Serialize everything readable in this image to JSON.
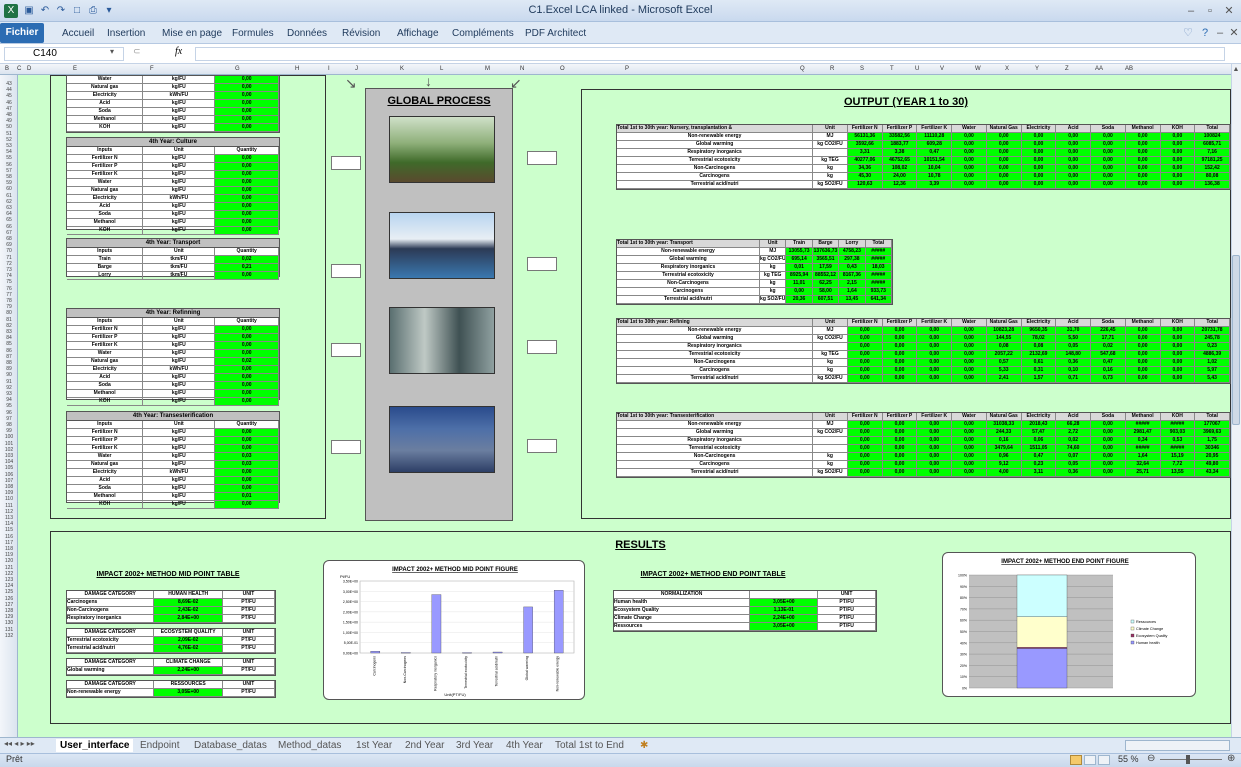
{
  "window": {
    "title": "C1.Excel LCA linked - Microsoft Excel"
  },
  "ribbon": {
    "file_tab": "Fichier",
    "tabs": [
      "Accueil",
      "Insertion",
      "Mise en page",
      "Formules",
      "Données",
      "Révision",
      "Affichage",
      "Compléments",
      "PDF Architect"
    ]
  },
  "formula": {
    "name_box": "C140",
    "fx": "fx",
    "value": ""
  },
  "columns": [
    "B",
    "C",
    "D",
    "E",
    "F",
    "G",
    "H",
    "I",
    "J",
    "K",
    "L",
    "M",
    "N",
    "O",
    "P",
    "Q",
    "R",
    "S",
    "T",
    "U",
    "V",
    "W",
    "X",
    "Y",
    "Z",
    "AA",
    "AB"
  ],
  "rows": [
    "43",
    "44",
    "45",
    "46",
    "47",
    "48",
    "49",
    "50",
    "51",
    "52",
    "53",
    "54",
    "55",
    "56",
    "57",
    "58",
    "59",
    "60",
    "61",
    "62",
    "63",
    "64",
    "65",
    "66",
    "67",
    "68",
    "69",
    "70",
    "71",
    "72",
    "73",
    "74",
    "75",
    "76",
    "77",
    "78",
    "79",
    "80",
    "81",
    "82",
    "83",
    "84",
    "85",
    "86",
    "87",
    "88",
    "89",
    "90",
    "91",
    "92",
    "93",
    "94",
    "95",
    "96",
    "97",
    "98",
    "99",
    "100",
    "101",
    "102",
    "103",
    "104",
    "105",
    "106",
    "107",
    "108",
    "109",
    "110",
    "111",
    "112",
    "113",
    "114",
    "115",
    "116",
    "117",
    "118",
    "119",
    "120",
    "121",
    "122",
    "123",
    "124",
    "125",
    "126",
    "127",
    "128",
    "129",
    "130",
    "131",
    "132"
  ],
  "left_tables": {
    "top": {
      "rows": [
        [
          "Water",
          "kg/FU",
          "0,00"
        ],
        [
          "Natural gas",
          "kg/FU",
          "0,00"
        ],
        [
          "Electricity",
          "kWh/FU",
          "0,00"
        ],
        [
          "Acid",
          "kg/FU",
          "0,00"
        ],
        [
          "Soda",
          "kg/FU",
          "0,00"
        ],
        [
          "Methanol",
          "kg/FU",
          "0,00"
        ],
        [
          "KOH",
          "kg/FU",
          "0,00"
        ]
      ]
    },
    "culture": {
      "title": "4th Year: Culture",
      "header": [
        "Inputs",
        "Unit",
        "Quantity"
      ],
      "rows": [
        [
          "Fertilizer N",
          "kg/FU",
          "0,00"
        ],
        [
          "Fertilizer P",
          "kg/FU",
          "0,00"
        ],
        [
          "Fertilizer K",
          "kg/FU",
          "0,00"
        ],
        [
          "Water",
          "kg/FU",
          "0,00"
        ],
        [
          "Natural gas",
          "kg/FU",
          "0,00"
        ],
        [
          "Electricity",
          "kWh/FU",
          "0,00"
        ],
        [
          "Acid",
          "kg/FU",
          "0,00"
        ],
        [
          "Soda",
          "kg/FU",
          "0,00"
        ],
        [
          "Methanol",
          "kg/FU",
          "0,00"
        ],
        [
          "KOH",
          "kg/FU",
          "0,00"
        ]
      ]
    },
    "transport": {
      "title": "4th Year: Transport",
      "header": [
        "Inputs",
        "Unit",
        "Quantity"
      ],
      "rows": [
        [
          "Train",
          "tkm/FU",
          "0,02"
        ],
        [
          "Barge",
          "tkm/FU",
          "0,21"
        ],
        [
          "Lorry",
          "tkm/FU",
          "0,00"
        ]
      ]
    },
    "refining": {
      "title": "4th Year: Refinning",
      "header": [
        "Inputs",
        "Unit",
        "Quantity"
      ],
      "rows": [
        [
          "Fertilizer N",
          "kg/FU",
          "0,00"
        ],
        [
          "Fertilizer P",
          "kg/FU",
          "0,00"
        ],
        [
          "Fertilizer K",
          "kg/FU",
          "0,00"
        ],
        [
          "Water",
          "kg/FU",
          "0,00"
        ],
        [
          "Natural gas",
          "kg/FU",
          "0,02"
        ],
        [
          "Electricity",
          "kWh/FU",
          "0,00"
        ],
        [
          "Acid",
          "kg/FU",
          "0,00"
        ],
        [
          "Soda",
          "kg/FU",
          "0,00"
        ],
        [
          "Methanol",
          "kg/FU",
          "0,00"
        ],
        [
          "KOH",
          "kg/FU",
          "0,00"
        ]
      ]
    },
    "transesterification": {
      "title": "4th Year: Transesterification",
      "header": [
        "Inputs",
        "Unit",
        "Quantity"
      ],
      "rows": [
        [
          "Fertilizer N",
          "kg/FU",
          "0,00"
        ],
        [
          "Fertilizer P",
          "kg/FU",
          "0,00"
        ],
        [
          "Fertilizer K",
          "kg/FU",
          "0,00"
        ],
        [
          "Water",
          "kg/FU",
          "0,03"
        ],
        [
          "Natural gas",
          "kg/FU",
          "0,03"
        ],
        [
          "Electricity",
          "kWh/FU",
          "0,00"
        ],
        [
          "Acid",
          "kg/FU",
          "0,00"
        ],
        [
          "Soda",
          "kg/FU",
          "0,00"
        ],
        [
          "Methanol",
          "kg/FU",
          "0,01"
        ],
        [
          "KOH",
          "kg/FU",
          "0,00"
        ]
      ]
    }
  },
  "global_process": {
    "title": "GLOBAL PROCESS"
  },
  "output": {
    "title": "OUTPUT (YEAR 1 to 30)",
    "nursery": {
      "title": "Total 1st to 30th year: Nursery, transplantation &",
      "cols": [
        "Unit",
        "Fertilizer N",
        "Fertilizer P",
        "Fertilizer K",
        "Water",
        "Natural Gas",
        "Electricity",
        "Acid",
        "Soda",
        "Methanol",
        "KOH",
        "Total"
      ],
      "rows": [
        [
          "Non-renewable energy",
          "MJ",
          "56131,36",
          "33582,56",
          "11110,28",
          "0,00",
          "0,00",
          "0,00",
          "0,00",
          "0,00",
          "0,00",
          "0,00",
          "100824"
        ],
        [
          "Global warming",
          "kg CO2/FU",
          "3592,66",
          "1883,77",
          "609,28",
          "0,00",
          "0,00",
          "0,00",
          "0,00",
          "0,00",
          "0,00",
          "0,00",
          "6085,71"
        ],
        [
          "Respiratory inorganics",
          "",
          "3,31",
          "3,38",
          "0,47",
          "0,00",
          "0,00",
          "0,00",
          "0,00",
          "0,00",
          "0,00",
          "0,00",
          "7,16"
        ],
        [
          "Terrestrial ecotoxicity",
          "kg TEG",
          "40277,06",
          "46752,65",
          "10151,54",
          "0,00",
          "0,00",
          "0,00",
          "0,00",
          "0,00",
          "0,00",
          "0,00",
          "97181,25"
        ],
        [
          "Non-Carcinogens",
          "kg",
          "34,36",
          "108,02",
          "10,04",
          "0,00",
          "0,00",
          "0,00",
          "0,00",
          "0,00",
          "0,00",
          "0,00",
          "152,42"
        ],
        [
          "Carcinogens",
          "kg",
          "45,30",
          "24,00",
          "10,78",
          "0,00",
          "0,00",
          "0,00",
          "0,00",
          "0,00",
          "0,00",
          "0,00",
          "80,08"
        ],
        [
          "Terrestrial acid/nutri",
          "kg SO2/FU",
          "120,63",
          "12,36",
          "3,39",
          "0,00",
          "0,00",
          "0,00",
          "0,00",
          "0,00",
          "0,00",
          "0,00",
          "136,38"
        ]
      ]
    },
    "transport": {
      "title": "Total 1st to 30th year: Transport",
      "cols": [
        "Unit",
        "Train",
        "Barge",
        "Lorry",
        "Total"
      ],
      "rows": [
        [
          "Non-renewable energy",
          "MJ",
          "13055,73",
          "137636,73",
          "4758,23",
          "#####"
        ],
        [
          "Global warming",
          "kg CO2/FU",
          "695,14",
          "3565,51",
          "297,38",
          "#####"
        ],
        [
          "Respiratory inorganics",
          "kg",
          "0,01",
          "17,59",
          "0,43",
          "18,03"
        ],
        [
          "Terrestrial ecotoxicity",
          "kg TEG",
          "8925,94",
          "88552,12",
          "8167,36",
          "#####"
        ],
        [
          "Non-Carcinogens",
          "kg",
          "11,01",
          "62,25",
          "2,15",
          "#####"
        ],
        [
          "Carcinogens",
          "kg",
          "0,00",
          "58,00",
          "1,64",
          "933,73"
        ],
        [
          "Terrestrial acid/nutri",
          "kg SO2/FU",
          "20,36",
          "607,51",
          "13,45",
          "641,34"
        ]
      ]
    },
    "refining": {
      "title": "Total 1st to 30th year: Refining",
      "cols": [
        "Unit",
        "Fertilizer N",
        "Fertilizer P",
        "Fertilizer K",
        "Water",
        "Natural Gas",
        "Electricity",
        "Acid",
        "Soda",
        "Methanol",
        "KOH",
        "Total"
      ],
      "rows": [
        [
          "Non-renewable energy",
          "MJ",
          "0,00",
          "0,00",
          "0,00",
          "0,00",
          "10823,28",
          "9650,35",
          "31,70",
          "226,45",
          "0,00",
          "0,00",
          "20731,78"
        ],
        [
          "Global warming",
          "kg CO2/FU",
          "0,00",
          "0,00",
          "0,00",
          "0,00",
          "144,55",
          "78,02",
          "5,50",
          "17,71",
          "0,00",
          "0,00",
          "245,78"
        ],
        [
          "Respiratory inorganics",
          "",
          "0,00",
          "0,00",
          "0,00",
          "0,00",
          "0,08",
          "0,08",
          "0,05",
          "0,02",
          "0,00",
          "0,00",
          "0,23"
        ],
        [
          "Terrestrial ecotoxicity",
          "kg TEG",
          "0,00",
          "0,00",
          "0,00",
          "0,00",
          "2057,22",
          "2132,69",
          "148,80",
          "547,68",
          "0,00",
          "0,00",
          "4886,39"
        ],
        [
          "Non-Carcinogens",
          "kg",
          "0,00",
          "0,00",
          "0,00",
          "0,00",
          "0,57",
          "0,61",
          "0,36",
          "0,47",
          "0,00",
          "0,00",
          "1,02"
        ],
        [
          "Carcinogens",
          "kg",
          "0,00",
          "0,00",
          "0,00",
          "0,00",
          "5,33",
          "0,31",
          "0,10",
          "0,16",
          "0,00",
          "0,00",
          "5,97"
        ],
        [
          "Terrestrial acid/nutri",
          "kg SO2/FU",
          "0,00",
          "0,00",
          "0,00",
          "0,00",
          "2,41",
          "1,57",
          "0,71",
          "0,73",
          "0,00",
          "0,00",
          "5,43"
        ]
      ]
    },
    "transesterification": {
      "title": "Total 1st to 30th year: Transesterification",
      "cols": [
        "Unit",
        "Fertilizer N",
        "Fertilizer P",
        "Fertilizer K",
        "Water",
        "Natural Gas",
        "Electricity",
        "Acid",
        "Soda",
        "Methanol",
        "KOH",
        "Total"
      ],
      "rows": [
        [
          "Non-renewable energy",
          "MJ",
          "0,00",
          "0,00",
          "0,00",
          "0,00",
          "31038,33",
          "2018,43",
          "66,28",
          "0,00",
          "#####",
          "#####",
          "177067"
        ],
        [
          "Global warming",
          "kg CO2/FU",
          "0,00",
          "0,00",
          "0,00",
          "0,00",
          "244,33",
          "57,47",
          "2,72",
          "0,00",
          "2981,47",
          "903,03",
          "3969,63"
        ],
        [
          "Respiratory inorganics",
          "",
          "0,00",
          "0,00",
          "0,00",
          "0,00",
          "0,16",
          "0,06",
          "0,02",
          "0,00",
          "0,34",
          "0,53",
          "1,75"
        ],
        [
          "Terrestrial ecotoxicity",
          "",
          "0,00",
          "0,00",
          "0,00",
          "0,00",
          "3479,64",
          "1511,05",
          "74,60",
          "0,00",
          "#####",
          "#####",
          "30346"
        ],
        [
          "Non-Carcinogens",
          "kg",
          "0,00",
          "0,00",
          "0,00",
          "0,00",
          "0,96",
          "0,47",
          "0,07",
          "0,00",
          "1,64",
          "15,19",
          "20,95"
        ],
        [
          "Carcinogens",
          "kg",
          "0,00",
          "0,00",
          "0,00",
          "0,00",
          "9,12",
          "0,23",
          "0,05",
          "0,00",
          "32,64",
          "7,72",
          "49,80"
        ],
        [
          "Terrestrial acid/nutri",
          "kg SO2/FU",
          "0,00",
          "0,00",
          "0,00",
          "0,00",
          "4,00",
          "3,11",
          "0,36",
          "0,00",
          "25,71",
          "13,55",
          "43,34"
        ]
      ]
    }
  },
  "results": {
    "title": "RESULTS",
    "mid_table": {
      "title": "IMPACT 2002+ METHOD MID POINT TABLE",
      "groups": [
        {
          "header": [
            "DAMAGE CATEGORY",
            "HUMAN HEALTH",
            "UNIT"
          ],
          "rows": [
            [
              "Carcinogens",
              "8,69E-02",
              "PT/FU"
            ],
            [
              "Non-Carcinogens",
              "2,43E-02",
              "PT/FU"
            ],
            [
              "Respiratory inorganics",
              "2,84E+00",
              "PT/FU"
            ]
          ]
        },
        {
          "header": [
            "DAMAGE CATEGORY",
            "ECOSYSTEM QUALITY",
            "UNIT"
          ],
          "rows": [
            [
              "Terrestrial ecotoxicity",
              "2,09E-02",
              "PT/FU"
            ],
            [
              "Terrestrial acid/nutri",
              "4,76E-02",
              "PT/FU"
            ]
          ]
        },
        {
          "header": [
            "DAMAGE CATEGORY",
            "CLIMATE CHANGE",
            "UNIT"
          ],
          "rows": [
            [
              "Global warming",
              "2,24E+00",
              "PT/FU"
            ]
          ]
        },
        {
          "header": [
            "DAMAGE CATEGORY",
            "RESSOURCES",
            "UNIT"
          ],
          "rows": [
            [
              "Non-renewable energy",
              "3,05E+00",
              "PT/FU"
            ]
          ]
        }
      ]
    },
    "mid_figure": {
      "title": "IMPACT 2002+ METHOD MID POINT FIGURE"
    },
    "end_table": {
      "title": "IMPACT 2002+ METHOD END POINT TABLE",
      "header": [
        "NORMALIZATION",
        "",
        "UNIT"
      ],
      "rows": [
        [
          "Human health",
          "3,05E+00",
          "PT/FU"
        ],
        [
          "Ecosystem Quality",
          "1,13E-01",
          "PT/FU"
        ],
        [
          "Climate Change",
          "2,24E+00",
          "PT/FU"
        ],
        [
          "Ressources",
          "3,05E+00",
          "PT/FU"
        ]
      ]
    },
    "end_figure": {
      "title": "IMPACT 2002+ METHOD END POINT FIGURE",
      "legend": [
        "Ressources",
        "Climate Change",
        "Ecosystem Quality",
        "Human health"
      ]
    }
  },
  "chart_data": [
    {
      "type": "bar",
      "title": "IMPACT 2002+ METHOD MID POINT FIGURE",
      "ylabel": "Pt/FU",
      "xlabel": "Unit(PT/FU)",
      "categories": [
        "Carcinogens",
        "Non-Carcinogens",
        "Respiratory inorganics",
        "Terrestrial ecotoxicity",
        "Terrestrial acid/nutri",
        "Global warming",
        "Non-renewable energy"
      ],
      "values": [
        0.087,
        0.024,
        2.84,
        0.021,
        0.048,
        2.24,
        3.05
      ],
      "ylim": [
        0,
        3.5
      ],
      "yticks": [
        "0,00E+00",
        "5,00E-01",
        "1,00E+00",
        "1,50E+00",
        "2,00E+00",
        "2,50E+00",
        "3,00E+00",
        "3,50E+00"
      ],
      "color": "#9999ff"
    },
    {
      "type": "bar",
      "title": "IMPACT 2002+ METHOD END POINT FIGURE",
      "stacked_percent": true,
      "series": [
        {
          "name": "Human health",
          "values": [
            35
          ],
          "color": "#9999ff"
        },
        {
          "name": "Ecosystem Quality",
          "values": [
            1
          ],
          "color": "#993366"
        },
        {
          "name": "Climate Change",
          "values": [
            27
          ],
          "color": "#ffffcc"
        },
        {
          "name": "Ressources",
          "values": [
            37
          ],
          "color": "#ccffff"
        }
      ],
      "yticks": [
        "0%",
        "10%",
        "20%",
        "30%",
        "40%",
        "50%",
        "60%",
        "70%",
        "80%",
        "90%",
        "100%"
      ]
    }
  ],
  "sheets": {
    "tabs": [
      "User_interface",
      "Endpoint",
      "Database_datas",
      "Method_datas",
      "1st Year",
      "2nd Year",
      "3rd Year",
      "4th Year",
      "Total 1st to End"
    ],
    "active": "User_interface"
  },
  "status": {
    "ready": "Prêt",
    "zoom": "55 %"
  }
}
